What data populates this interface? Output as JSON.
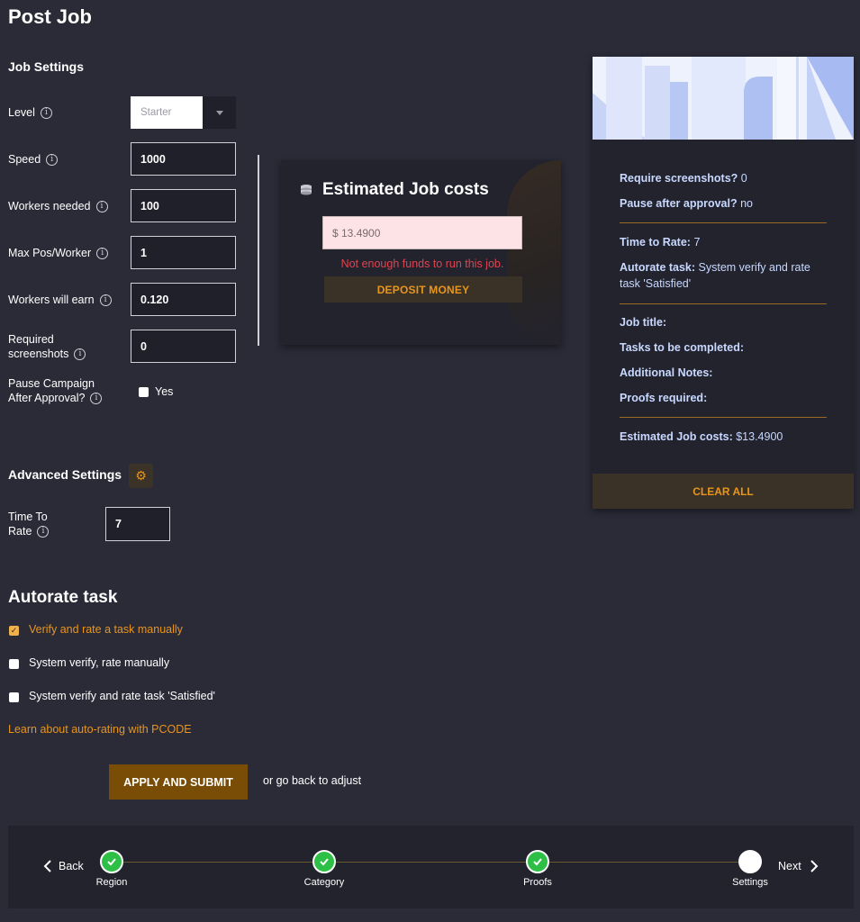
{
  "page": {
    "title": "Post Job"
  },
  "job_settings": {
    "title": "Job Settings",
    "level": {
      "label": "Level",
      "value": "Starter"
    },
    "speed": {
      "label": "Speed",
      "value": "1000"
    },
    "workers_needed": {
      "label": "Workers needed",
      "value": "100"
    },
    "max_pos_worker": {
      "label": "Max Pos/Worker",
      "value": "1"
    },
    "workers_will_earn": {
      "label": "Workers will earn",
      "value": "0.120"
    },
    "required_screenshots": {
      "label_line1": "Required",
      "label_line2": "screenshots",
      "value": "0"
    },
    "pause_campaign": {
      "label_line1": "Pause Campaign",
      "label_line2": "After Approval?",
      "checkbox_label": "Yes",
      "checked": false
    }
  },
  "cost_card": {
    "title": "Estimated Job costs",
    "amount": "$ 13.4900",
    "error": "Not enough funds to run this job.",
    "deposit_label": "DEPOSIT MONEY"
  },
  "summary": {
    "require_screenshots_label": "Require screenshots?",
    "require_screenshots_value": "0",
    "pause_after_approval_label": "Pause after approval?",
    "pause_after_approval_value": "no",
    "time_to_rate_label": "Time to Rate:",
    "time_to_rate_value": "7",
    "autorate_label": "Autorate task:",
    "autorate_value_line1": "System verify and rate",
    "autorate_value_line2": "task 'Satisfied'",
    "job_title_label": "Job title:",
    "tasks_label": "Tasks to be completed:",
    "notes_label": "Additional Notes:",
    "proofs_label": "Proofs required:",
    "estimated_costs_label": "Estimated Job costs:",
    "estimated_costs_value": "$13.4900",
    "clear_label": "CLEAR ALL"
  },
  "advanced": {
    "title": "Advanced Settings",
    "time_to_rate": {
      "label_line1": "Time To",
      "label_line2": "Rate",
      "value": "7"
    }
  },
  "autorate": {
    "title": "Autorate task",
    "options": [
      {
        "label": "Verify and rate a task manually",
        "checked": true
      },
      {
        "label": "System verify, rate manually",
        "checked": false
      },
      {
        "label": "System verify and rate task 'Satisfied'",
        "checked": false
      }
    ],
    "learn_link": "Learn about auto-rating with PCODE"
  },
  "actions": {
    "apply_label": "APPLY AND SUBMIT",
    "back_text": "or go back to adjust"
  },
  "stepper": {
    "back_label": "Back",
    "next_label": "Next",
    "steps": [
      {
        "label": "Region",
        "state": "done"
      },
      {
        "label": "Category",
        "state": "done"
      },
      {
        "label": "Proofs",
        "state": "done"
      },
      {
        "label": "Settings",
        "state": "current"
      }
    ]
  },
  "colors": {
    "background": "#2b2b38",
    "panel": "#23232e",
    "accent_orange": "#e8951c",
    "error_red": "#e0434f",
    "summary_text": "#c8d8ff",
    "step_done": "#2ec046"
  }
}
